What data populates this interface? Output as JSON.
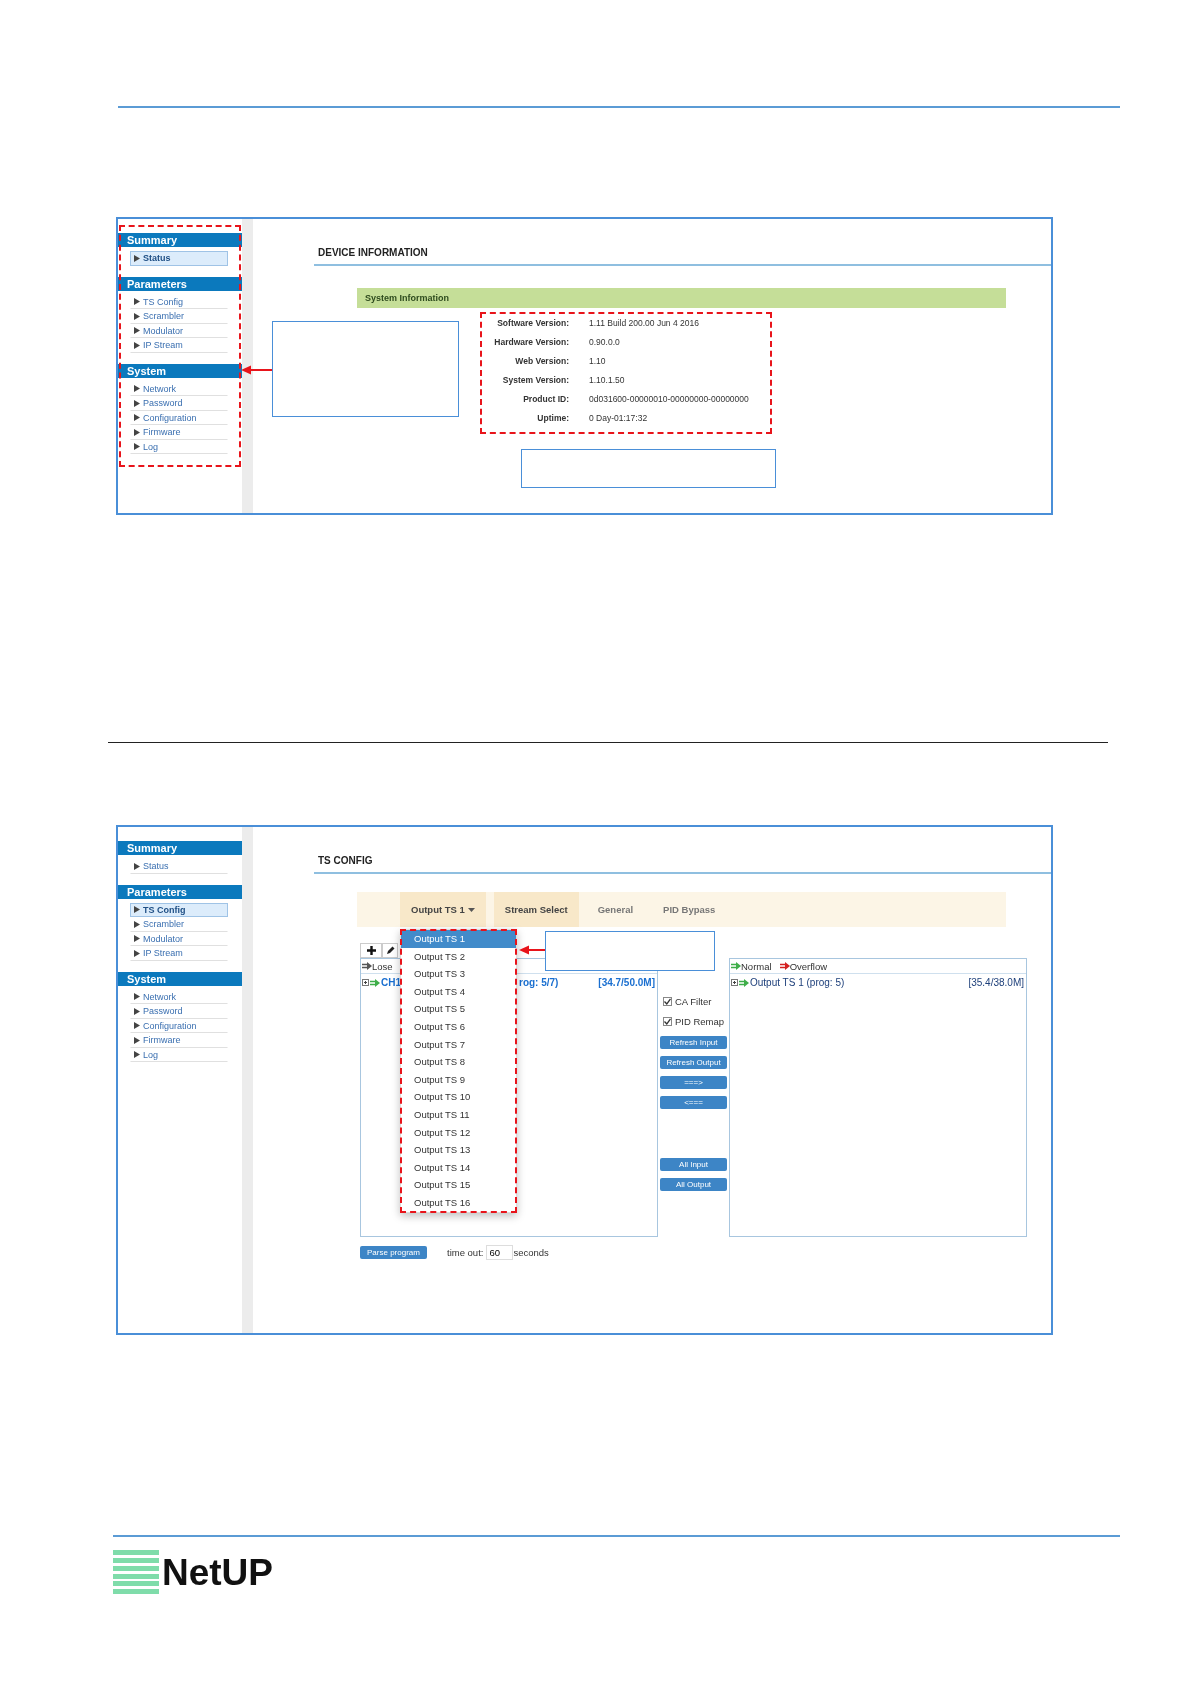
{
  "status_screen": {
    "sidebar": [
      {
        "title": "Summary",
        "items": [
          {
            "label": "Status",
            "selected": true
          }
        ]
      },
      {
        "title": "Parameters",
        "items": [
          {
            "label": "TS Config",
            "selected": false
          },
          {
            "label": "Scrambler",
            "selected": false
          },
          {
            "label": "Modulator",
            "selected": false
          },
          {
            "label": "IP Stream",
            "selected": false
          }
        ]
      },
      {
        "title": "System",
        "items": [
          {
            "label": "Network",
            "selected": false
          },
          {
            "label": "Password",
            "selected": false
          },
          {
            "label": "Configuration",
            "selected": false
          },
          {
            "label": "Firmware",
            "selected": false
          },
          {
            "label": "Log",
            "selected": false
          }
        ]
      }
    ],
    "page_title": "DEVICE INFORMATION",
    "section_title": "System Information",
    "info": [
      {
        "label": "Software Version:",
        "value": "1.11 Build 200.00 Jun 4 2016"
      },
      {
        "label": "Hardware Version:",
        "value": "0.90.0.0"
      },
      {
        "label": "Web Version:",
        "value": "1.10"
      },
      {
        "label": "System Version:",
        "value": "1.10.1.50"
      },
      {
        "label": "Product ID:",
        "value": "0d031600-00000010-00000000-00000000"
      },
      {
        "label": "Uptime:",
        "value": "0 Day-01:17:32"
      }
    ]
  },
  "ts_config_screen": {
    "sidebar": [
      {
        "title": "Summary",
        "items": [
          {
            "label": "Status",
            "selected": false
          }
        ]
      },
      {
        "title": "Parameters",
        "items": [
          {
            "label": "TS Config",
            "selected": true
          },
          {
            "label": "Scrambler",
            "selected": false
          },
          {
            "label": "Modulator",
            "selected": false
          },
          {
            "label": "IP Stream",
            "selected": false
          }
        ]
      },
      {
        "title": "System",
        "items": [
          {
            "label": "Network",
            "selected": false
          },
          {
            "label": "Password",
            "selected": false
          },
          {
            "label": "Configuration",
            "selected": false
          },
          {
            "label": "Firmware",
            "selected": false
          },
          {
            "label": "Log",
            "selected": false
          }
        ]
      }
    ],
    "page_title": "TS CONFIG",
    "tabs": [
      {
        "label": "Output TS 1",
        "kind": "dropdown",
        "selected": true
      },
      {
        "label": "Stream Select",
        "kind": "tab",
        "selected": true
      },
      {
        "label": "General",
        "kind": "tab",
        "selected": false
      },
      {
        "label": "PID Bypass",
        "kind": "tab",
        "selected": false
      }
    ],
    "dropdown_menu": [
      {
        "label": "Output TS 1",
        "selected": true
      },
      {
        "label": "Output TS 2",
        "selected": false
      },
      {
        "label": "Output TS 3",
        "selected": false
      },
      {
        "label": "Output TS 4",
        "selected": false
      },
      {
        "label": "Output TS 5",
        "selected": false
      },
      {
        "label": "Output TS 6",
        "selected": false
      },
      {
        "label": "Output TS 7",
        "selected": false
      },
      {
        "label": "Output TS 8",
        "selected": false
      },
      {
        "label": "Output TS 9",
        "selected": false
      },
      {
        "label": "Output TS 10",
        "selected": false
      },
      {
        "label": "Output TS 11",
        "selected": false
      },
      {
        "label": "Output TS 12",
        "selected": false
      },
      {
        "label": "Output TS 13",
        "selected": false
      },
      {
        "label": "Output TS 14",
        "selected": false
      },
      {
        "label": "Output TS 15",
        "selected": false
      },
      {
        "label": "Output TS 16",
        "selected": false
      }
    ],
    "input_panel": {
      "legend": [
        {
          "label": "Lose",
          "color": "#555555"
        }
      ],
      "rows": [
        {
          "name": "CH1",
          "detail": "rog: 5/7)",
          "rate": "[34.7/50.0M]"
        }
      ]
    },
    "options": [
      {
        "label": "CA Filter",
        "checked": true
      },
      {
        "label": "PID Remap",
        "checked": true
      }
    ],
    "button_groups": [
      [
        "Refresh Input",
        "Refresh Output",
        "===>",
        "<==="
      ],
      [
        "All Input",
        "All Output"
      ]
    ],
    "output_panel": {
      "legend": [
        {
          "label": "Normal",
          "color": "#3fae49"
        },
        {
          "label": "Overflow",
          "color": "#d42020"
        }
      ],
      "rows": [
        {
          "name": "Output TS 1 (prog: 5)",
          "rate": "[35.4/38.0M]"
        }
      ]
    },
    "parse_button": "Parse program",
    "timeout": {
      "label": "time out:",
      "value": "60",
      "unit": "seconds"
    }
  },
  "logo": "NetUP"
}
